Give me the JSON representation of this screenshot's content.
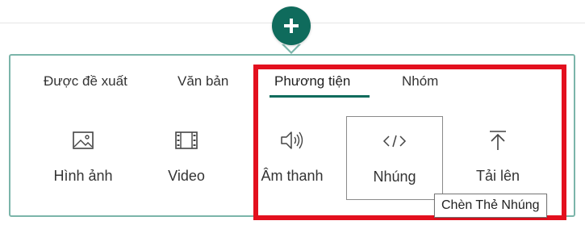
{
  "add_button": {
    "icon": "plus-icon",
    "color": "#0f6b5c"
  },
  "tabs": [
    {
      "label": "Được đề xuất",
      "selected": false
    },
    {
      "label": "Văn bản",
      "selected": false
    },
    {
      "label": "Phương tiện",
      "selected": true
    },
    {
      "label": "Nhóm",
      "selected": false
    }
  ],
  "tiles": [
    {
      "label": "Hình ảnh",
      "icon": "image-icon"
    },
    {
      "label": "Video",
      "icon": "film-icon"
    },
    {
      "label": "Âm thanh",
      "icon": "speaker-icon"
    },
    {
      "label": "Nhúng",
      "icon": "code-icon",
      "focused": true
    },
    {
      "label": "Tải lên",
      "icon": "upload-icon"
    }
  ],
  "tooltip": {
    "text": "Chèn Thẻ Nhúng"
  },
  "colors": {
    "accent": "#0f6b5c",
    "panel_border": "#7bb5aa",
    "highlight": "#e3101e"
  }
}
